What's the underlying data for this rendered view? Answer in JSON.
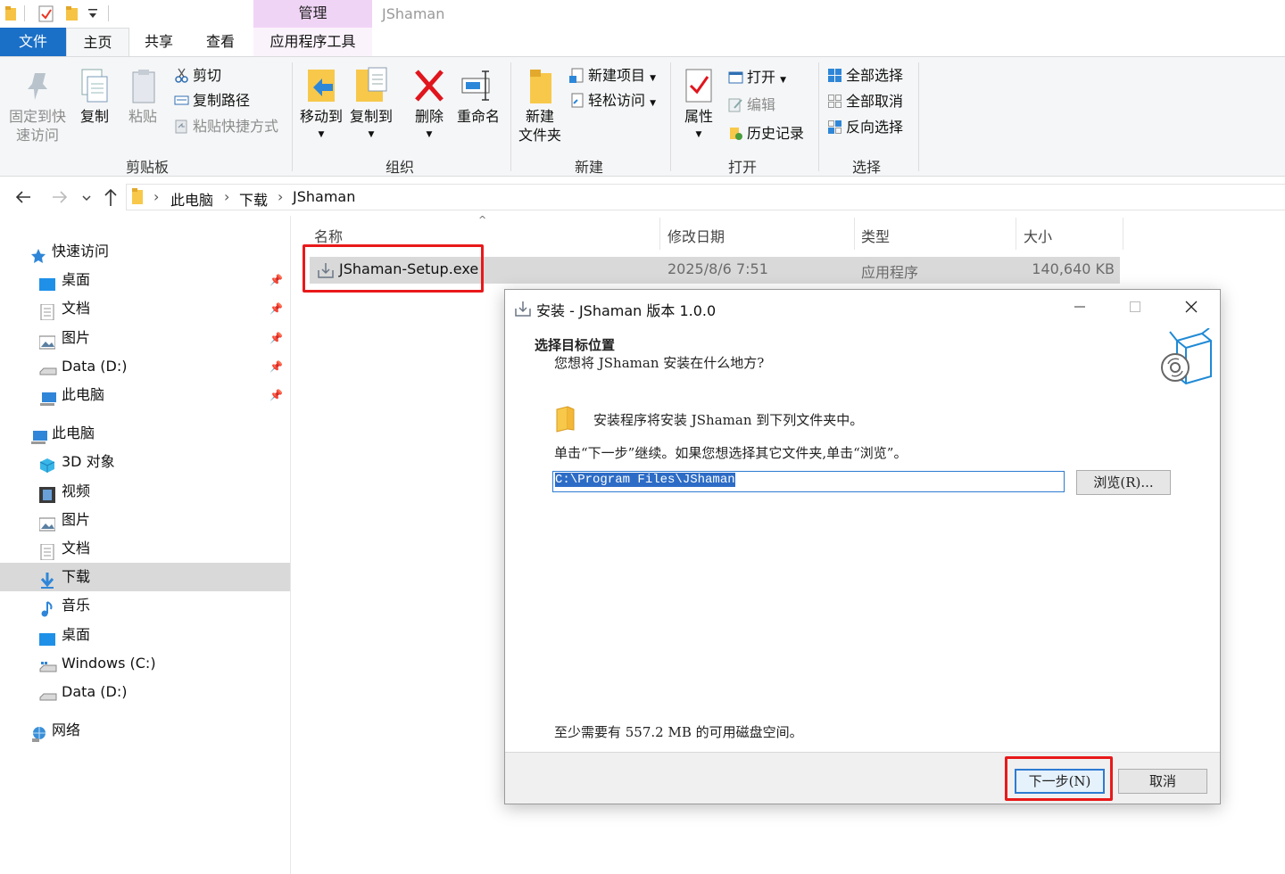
{
  "title_bar": {
    "context_tab": "管理",
    "window_title": "JShaman"
  },
  "tabs": {
    "file": "文件",
    "home": "主页",
    "share": "共享",
    "view": "查看",
    "app_tools": "应用程序工具"
  },
  "ribbon": {
    "clipboard": {
      "pin": [
        "固定到快",
        "速访问"
      ],
      "copy": "复制",
      "paste": "粘贴",
      "cut": "剪切",
      "copy_path": "复制路径",
      "paste_shortcut": "粘贴快捷方式",
      "label": "剪贴板"
    },
    "organize": {
      "move_to": "移动到",
      "copy_to": "复制到",
      "delete": "删除",
      "rename": "重命名",
      "label": "组织"
    },
    "new": {
      "new_folder": [
        "新建",
        "文件夹"
      ],
      "new_item": "新建项目",
      "easy_access": "轻松访问",
      "label": "新建"
    },
    "open": {
      "properties": "属性",
      "open": "打开",
      "edit": "编辑",
      "history": "历史记录",
      "label": "打开"
    },
    "select": {
      "select_all": "全部选择",
      "select_none": "全部取消",
      "invert": "反向选择",
      "label": "选择"
    }
  },
  "breadcrumb": [
    "此电脑",
    "下载",
    "JShaman"
  ],
  "sidebar": {
    "quick_access": "快速访问",
    "quick_items": [
      "桌面",
      "文档",
      "图片",
      "Data (D:)",
      "此电脑"
    ],
    "this_pc": "此电脑",
    "pc_items": [
      "3D 对象",
      "视频",
      "图片",
      "文档",
      "下载",
      "音乐",
      "桌面",
      "Windows (C:)",
      "Data (D:)"
    ],
    "network": "网络"
  },
  "file_list": {
    "columns": [
      "名称",
      "修改日期",
      "类型",
      "大小"
    ],
    "rows": [
      {
        "name": "JShaman-Setup.exe",
        "date": "2025/8/6 7:51",
        "type": "应用程序",
        "size": "140,640 KB"
      }
    ]
  },
  "dialog": {
    "title": "安装 - JShaman 版本 1.0.0",
    "heading": "选择目标位置",
    "subheading": "您想将 JShaman 安装在什么地方?",
    "info": "安装程序将安装 JShaman 到下列文件夹中。",
    "instruction": "单击“下一步”继续。如果您想选择其它文件夹,单击“浏览”。",
    "path": "C:\\Program Files\\JShaman",
    "browse": "浏览(R)...",
    "space": "至少需要有 557.2 MB 的可用磁盘空间。",
    "next": "下一步(N)",
    "cancel": "取消"
  },
  "colors": {
    "accent": "#1a6fc7",
    "context_tab": "#f0d4f6",
    "highlight": "#e8191a"
  }
}
